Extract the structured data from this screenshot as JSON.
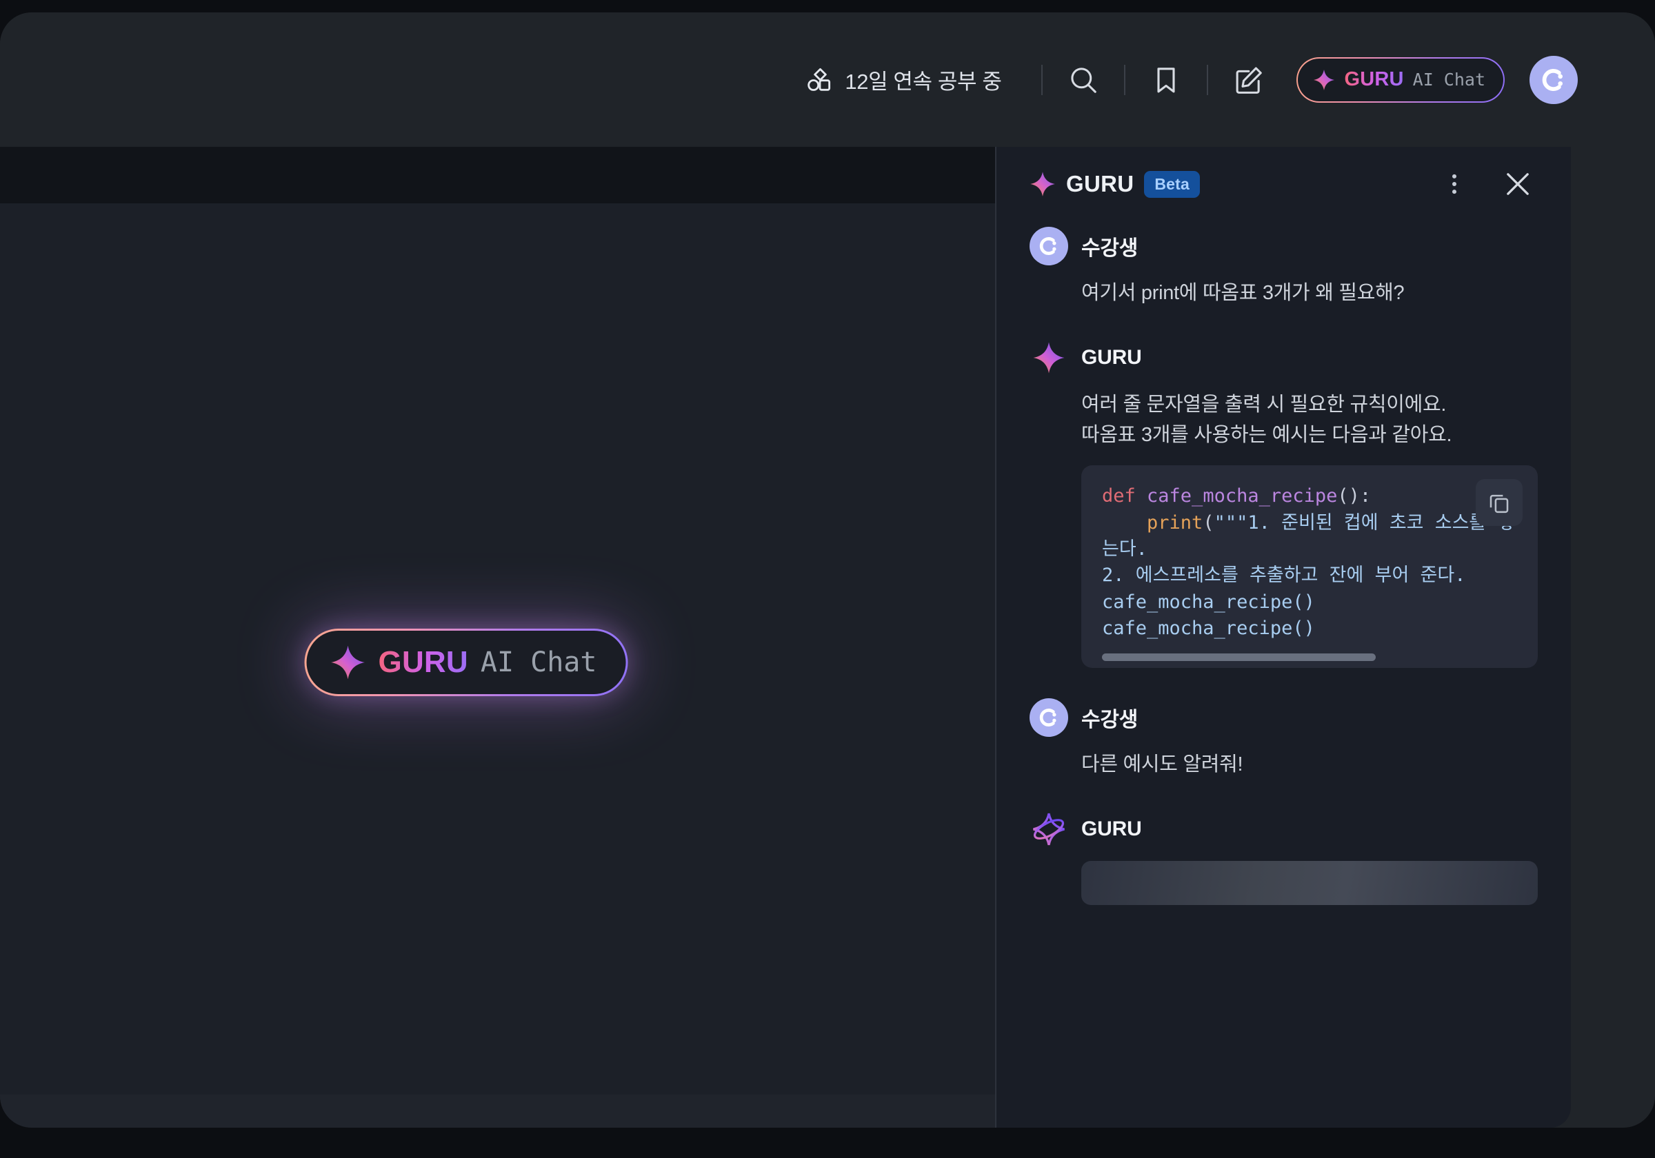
{
  "header": {
    "streak_icon": "shapes-icon",
    "streak_label": "12일 연속 공부 중",
    "search_icon": "search-icon",
    "bookmark_icon": "bookmark-icon",
    "compose_icon": "compose-icon",
    "guru_pill": {
      "sparkle_icon": "sparkle-icon",
      "brand": "GURU",
      "suffix": "AI Chat"
    },
    "avatar_icon": "user-avatar-icon"
  },
  "content": {
    "cta": {
      "sparkle_icon": "sparkle-icon",
      "brand": "GURU",
      "suffix": "AI Chat"
    }
  },
  "panel": {
    "sparkle_icon": "sparkle-icon",
    "title": "GURU",
    "badge": "Beta",
    "more_icon": "more-vertical-icon",
    "close_icon": "close-icon",
    "messages": [
      {
        "author": "수강생",
        "avatar": "user-avatar-icon",
        "text": "여기서 print에 따옴표 3개가 왜 필요해?"
      },
      {
        "author": "GURU",
        "avatar": "sparkle-icon",
        "line1": "여러 줄 문자열을 출력 시 필요한 규칙이에요.",
        "line2": "따옴표 3개를 사용하는 예시는 다음과 같아요."
      },
      {
        "author": "수강생",
        "avatar": "user-avatar-icon",
        "text": "다른 예시도 알려줘!"
      },
      {
        "author": "GURU",
        "avatar": "sparkle-spin-icon",
        "loading": true
      }
    ],
    "code_block": {
      "copy_icon": "copy-icon",
      "line1_kw": "def",
      "line1_fn": " cafe_mocha_recipe",
      "line1_pun": "():",
      "line2_call": "    print",
      "line2_pun": "(",
      "line2_str": "\"\"\"1. 준비된 컵에 초코 소스를 넣는다.",
      "line3_str": "2. 에스프레소를 추출하고 잔에 부어 준다.",
      "line4": "cafe_mocha_recipe()",
      "line5": "cafe_mocha_recipe()"
    }
  },
  "colors": {
    "accent_pink": "#f4657f",
    "accent_purple": "#9b6ef5",
    "avatar_bg": "#aab0f2",
    "badge_bg": "#14509c",
    "code_bg": "#272b38"
  }
}
